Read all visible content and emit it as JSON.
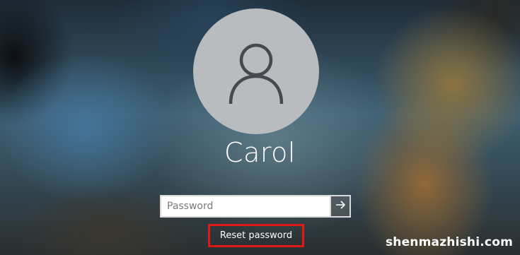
{
  "user": {
    "name": "Carol",
    "avatar_icon": "user-silhouette-icon"
  },
  "password": {
    "placeholder": "Password",
    "value": "",
    "submit_icon": "arrow-right-icon"
  },
  "links": {
    "reset_password": "Reset password"
  },
  "watermark": "shenmazhishi.com",
  "colors": {
    "avatar_bg": "#b9bcbf",
    "icon_stroke": "#444a50",
    "highlight_box": "#e01818",
    "text": "#ffffff"
  }
}
